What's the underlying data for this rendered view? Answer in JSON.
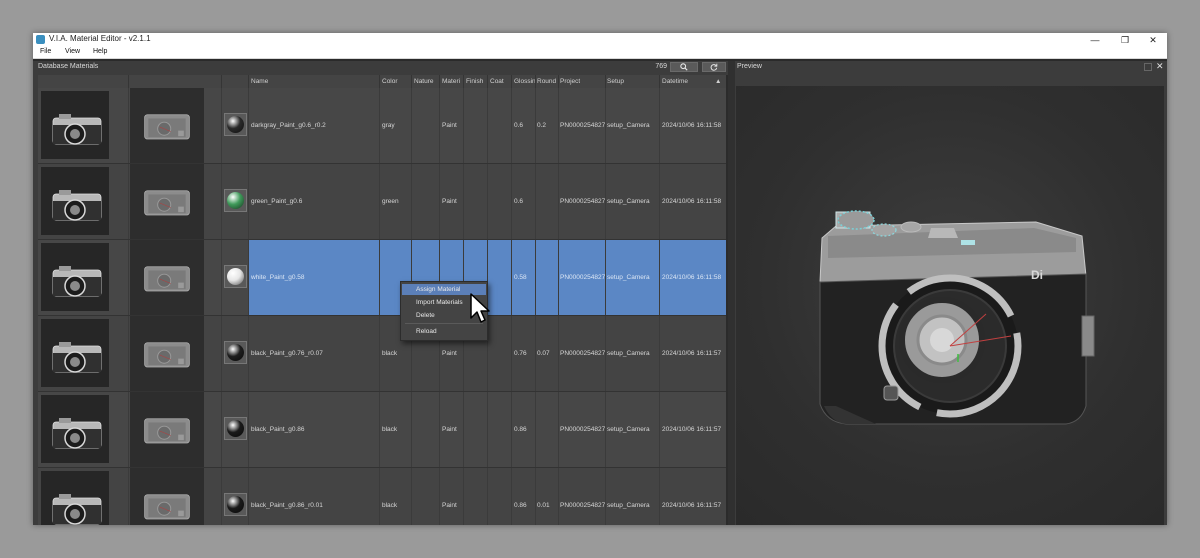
{
  "window": {
    "title": "V.I.A. Material Editor - v2.1.1",
    "controls": [
      "—",
      "❐",
      "✕"
    ]
  },
  "menu": [
    "File",
    "View",
    "Help"
  ],
  "database": {
    "label": "Database Materials",
    "count": "769",
    "search_icon": "search-icon",
    "refresh_icon": "refresh-icon"
  },
  "columns": [
    "Name",
    "Color",
    "Nature",
    "Materi",
    "Finish",
    "Coat",
    "Glossin",
    "Round",
    "Project",
    "Setup",
    "Datetime"
  ],
  "sort_indicator": "▲",
  "rows": [
    {
      "name": "darkgray_Paint_g0.6_r0.2",
      "color": "gray",
      "nature": "",
      "material": "Paint",
      "finish": "",
      "coat": "",
      "gloss": "0.6",
      "round": "0.2",
      "project": "PN0000254827",
      "setup": "setup_Camera",
      "datetime": "2024/10/06 16:11:58",
      "ball": "#2a2a2a"
    },
    {
      "name": "green_Paint_g0.6",
      "color": "green",
      "nature": "",
      "material": "Paint",
      "finish": "",
      "coat": "",
      "gloss": "0.6",
      "round": "",
      "project": "PN0000254827",
      "setup": "setup_Camera",
      "datetime": "2024/10/06 16:11:58",
      "ball": "#3f9a5a"
    },
    {
      "name": "white_Paint_g0.58",
      "color": "",
      "nature": "",
      "material": "",
      "finish": "",
      "coat": "",
      "gloss": "0.58",
      "round": "",
      "project": "PN0000254827",
      "setup": "setup_Camera",
      "datetime": "2024/10/06 16:11:58",
      "ball": "#e6e6e6",
      "selected": true
    },
    {
      "name": "black_Paint_g0.76_r0.07",
      "color": "black",
      "nature": "",
      "material": "Paint",
      "finish": "",
      "coat": "",
      "gloss": "0.76",
      "round": "0.07",
      "project": "PN0000254827",
      "setup": "setup_Camera",
      "datetime": "2024/10/06 16:11:57",
      "ball": "#1e1e1e"
    },
    {
      "name": "black_Paint_g0.86",
      "color": "black",
      "nature": "",
      "material": "Paint",
      "finish": "",
      "coat": "",
      "gloss": "0.86",
      "round": "",
      "project": "PN0000254827",
      "setup": "setup_Camera",
      "datetime": "2024/10/06 16:11:57",
      "ball": "#1a1a1a"
    },
    {
      "name": "black_Paint_g0.86_r0.01",
      "color": "black",
      "nature": "",
      "material": "Paint",
      "finish": "",
      "coat": "",
      "gloss": "0.86",
      "round": "0.01",
      "project": "PN0000254827",
      "setup": "setup_Camera",
      "datetime": "2024/10/06 16:11:57",
      "ball": "#1a1a1a"
    }
  ],
  "context_menu": [
    "Assign Material",
    "Import Materials",
    "Delete",
    "Reload"
  ],
  "preview": {
    "label": "Preview",
    "close": "✕",
    "camera_badge": "Di"
  },
  "colors": {
    "selection": "#5b87c5",
    "menu_active": "#5b7fb8",
    "panel": "#3c3c3c"
  }
}
